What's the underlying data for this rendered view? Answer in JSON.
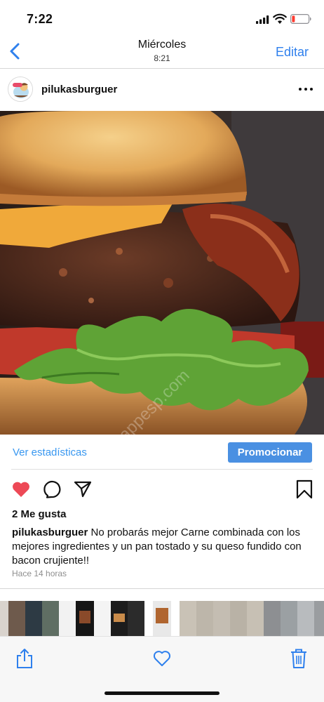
{
  "status_bar": {
    "time": "7:22"
  },
  "nav": {
    "back_icon": "chevron-left-icon",
    "title": "Miércoles",
    "subtitle": "8:21",
    "edit_label": "Editar",
    "accent_color": "#2f80ed"
  },
  "post": {
    "username": "pilukasburguer",
    "more_icon": "ellipsis-icon",
    "image_subject": "burger photo",
    "watermark": "mappesp.com",
    "stats_label": "Ver estadísticas",
    "promote_label": "Promocionar",
    "promote_color": "#4a90e2",
    "actions": [
      "heart-filled-icon",
      "comment-icon",
      "share-icon",
      "bookmark-icon"
    ],
    "like_color": "#ed4956",
    "likes": "2 Me gusta",
    "caption_user": "pilukasburguer",
    "caption_text": "No probarás mejor Carne combinada con los mejores ingredientes y un pan tostado y su queso fundido con bacon crujiente!!",
    "time_ago": "Hace 14 horas"
  },
  "toolbar": {
    "share_icon": "share-icon",
    "favorite_icon": "heart-icon",
    "delete_icon": "trash-icon",
    "icon_color": "#2f80ed"
  }
}
